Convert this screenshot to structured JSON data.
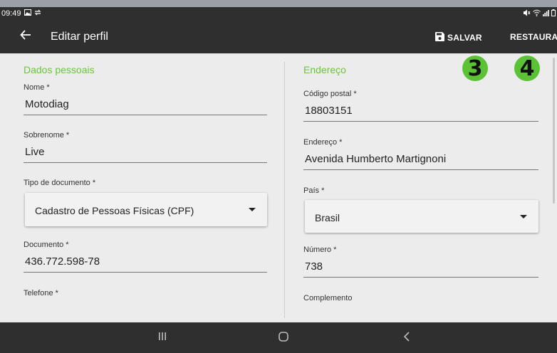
{
  "status_bar": {
    "time": "09:49",
    "left_icons": [
      "image-icon",
      "sync-icon"
    ],
    "right_icons": [
      "mute-icon",
      "wifi-icon",
      "signal-icon",
      "battery-icon"
    ]
  },
  "app_bar": {
    "title": "Editar perfil",
    "save_label": "SALVAR",
    "restore_label": "RESTAURA"
  },
  "badges": [
    "3",
    "4"
  ],
  "personal": {
    "section_title": "Dados pessoais",
    "first_name": {
      "label": "Nome *",
      "value": "Motodiag"
    },
    "last_name": {
      "label": "Sobrenome *",
      "value": "Live"
    },
    "doc_type": {
      "label": "Tipo de documento *",
      "value": "Cadastro de Pessoas Físicas (CPF)"
    },
    "document": {
      "label": "Documento *",
      "value": "436.772.598-78"
    },
    "phone": {
      "label": "Telefone *"
    }
  },
  "address": {
    "section_title": "Endereço",
    "postal_code": {
      "label": "Código postal *",
      "value": "18803151"
    },
    "street": {
      "label": "Endereço *",
      "value": "Avenida Humberto Martignoni"
    },
    "country": {
      "label": "País *",
      "value": "Brasil"
    },
    "number": {
      "label": "Número *",
      "value": "738"
    },
    "complement": {
      "label": "Complemento"
    }
  },
  "colors": {
    "accent": "#6cc43e",
    "badge": "#5bc236",
    "bar": "#2f2f2f",
    "background": "#ececec"
  }
}
